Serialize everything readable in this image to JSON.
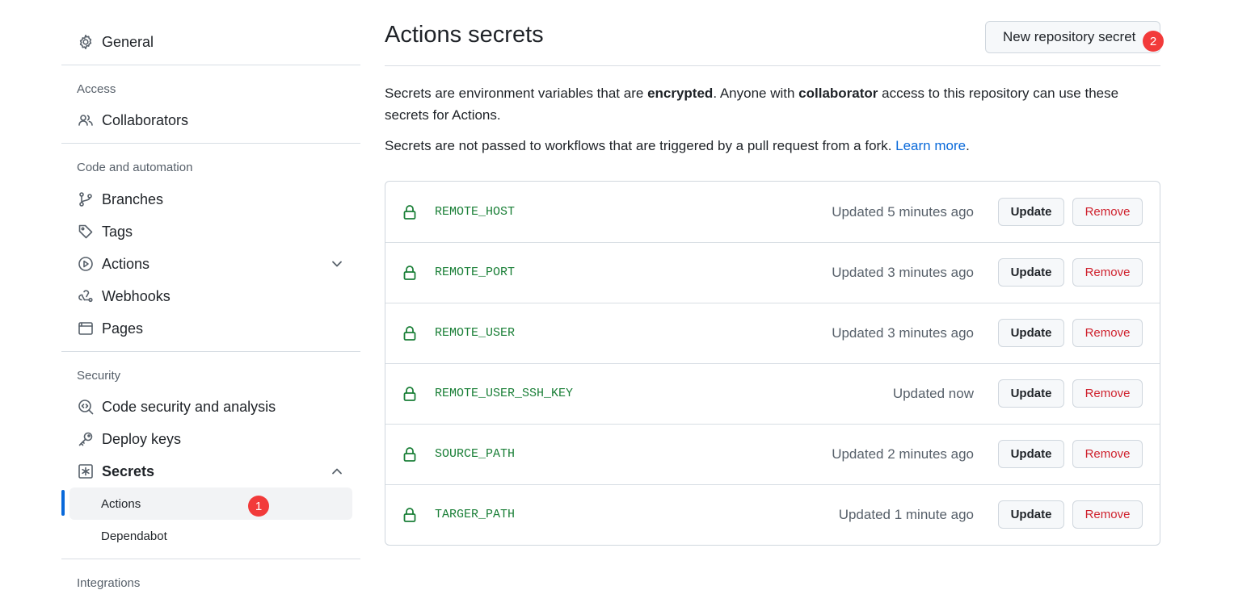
{
  "sidebar": {
    "general": "General",
    "access_heading": "Access",
    "collaborators": "Collaborators",
    "code_heading": "Code and automation",
    "branches": "Branches",
    "tags": "Tags",
    "actions": "Actions",
    "webhooks": "Webhooks",
    "pages": "Pages",
    "security_heading": "Security",
    "code_security": "Code security and analysis",
    "deploy_keys": "Deploy keys",
    "secrets": "Secrets",
    "secrets_actions": "Actions",
    "secrets_dependabot": "Dependabot",
    "integrations_heading": "Integrations",
    "badge_1": "1"
  },
  "main": {
    "title": "Actions secrets",
    "new_button": "New repository secret",
    "badge_2": "2",
    "desc1_a": "Secrets are environment variables that are ",
    "desc1_b": "encrypted",
    "desc1_c": ". Anyone with ",
    "desc1_d": "collaborator",
    "desc1_e": " access to this repository can use these secrets for Actions.",
    "desc2": "Secrets are not passed to workflows that are triggered by a pull request from a fork. ",
    "learn_more": "Learn more",
    "desc2_end": "."
  },
  "secrets": [
    {
      "name": "REMOTE_HOST",
      "updated": "Updated 5 minutes ago",
      "update_label": "Update",
      "remove_label": "Remove"
    },
    {
      "name": "REMOTE_PORT",
      "updated": "Updated 3 minutes ago",
      "update_label": "Update",
      "remove_label": "Remove"
    },
    {
      "name": "REMOTE_USER",
      "updated": "Updated 3 minutes ago",
      "update_label": "Update",
      "remove_label": "Remove"
    },
    {
      "name": "REMOTE_USER_SSH_KEY",
      "updated": "Updated now",
      "update_label": "Update",
      "remove_label": "Remove"
    },
    {
      "name": "SOURCE_PATH",
      "updated": "Updated 2 minutes ago",
      "update_label": "Update",
      "remove_label": "Remove"
    },
    {
      "name": "TARGER_PATH",
      "updated": "Updated 1 minute ago",
      "update_label": "Update",
      "remove_label": "Remove"
    }
  ],
  "colors": {
    "accent": "#0969da",
    "secret_green": "#1a7f37",
    "danger": "#cf222e",
    "badge": "#f23a3a"
  }
}
